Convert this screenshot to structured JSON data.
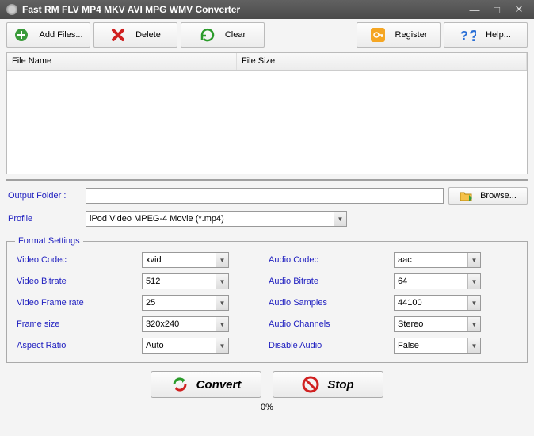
{
  "title": "Fast RM FLV MP4 MKV AVI MPG WMV Converter",
  "toolbar": {
    "add": "Add Files...",
    "delete": "Delete",
    "clear": "Clear",
    "register": "Register",
    "help": "Help..."
  },
  "filelist": {
    "col_name": "File Name",
    "col_size": "File Size"
  },
  "output": {
    "label": "Output Folder :",
    "value": "",
    "browse": "Browse..."
  },
  "profile": {
    "label": "Profile",
    "value": "iPod Video MPEG-4 Movie (*.mp4)"
  },
  "format": {
    "legend": "Format Settings",
    "video_codec_l": "Video Codec",
    "video_codec": "xvid",
    "video_bitrate_l": "Video Bitrate",
    "video_bitrate": "512",
    "video_framerate_l": "Video Frame rate",
    "video_framerate": "25",
    "frame_size_l": "Frame size",
    "frame_size": "320x240",
    "aspect_l": "Aspect Ratio",
    "aspect": "Auto",
    "audio_codec_l": "Audio Codec",
    "audio_codec": "aac",
    "audio_bitrate_l": "Audio Bitrate",
    "audio_bitrate": "64",
    "audio_samples_l": "Audio Samples",
    "audio_samples": "44100",
    "audio_channels_l": "Audio Channels",
    "audio_channels": "Stereo",
    "disable_audio_l": "Disable Audio",
    "disable_audio": "False"
  },
  "actions": {
    "convert": "Convert",
    "stop": "Stop"
  },
  "progress": "0%"
}
